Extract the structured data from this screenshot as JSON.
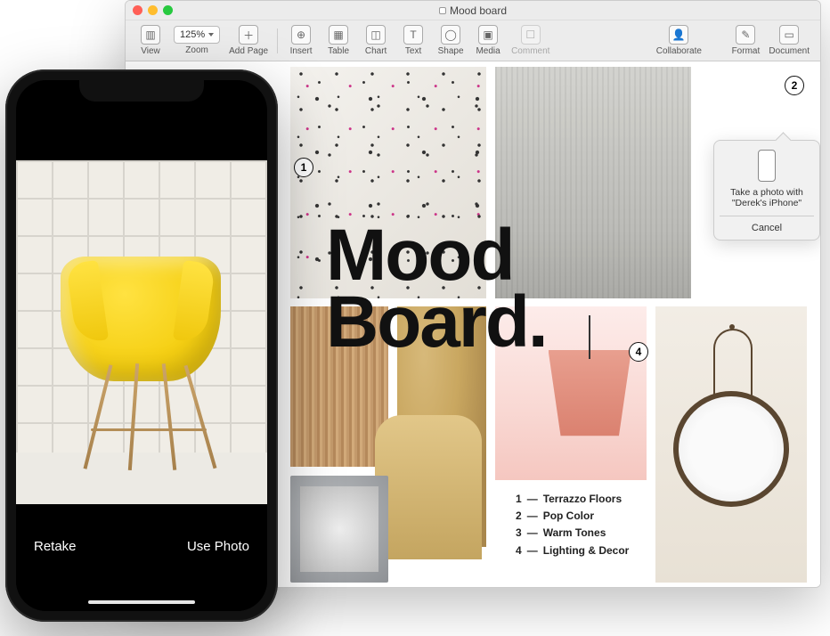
{
  "window": {
    "title": "Mood board",
    "toolbar": {
      "view": "View",
      "zoom_value": "125%",
      "zoom_label": "Zoom",
      "add_page": "Add Page",
      "insert": "Insert",
      "table": "Table",
      "chart": "Chart",
      "text": "Text",
      "shape": "Shape",
      "media": "Media",
      "comment": "Comment",
      "collaborate": "Collaborate",
      "format": "Format",
      "document": "Document"
    }
  },
  "document": {
    "headline_line1": "Mood",
    "headline_line2": "Board.",
    "callouts": {
      "c1": "1",
      "c2": "2",
      "c4": "4"
    },
    "legend": [
      {
        "n": "1",
        "label": "Terrazzo Floors"
      },
      {
        "n": "2",
        "label": "Pop Color"
      },
      {
        "n": "3",
        "label": "Warm Tones"
      },
      {
        "n": "4",
        "label": "Lighting & Decor"
      }
    ]
  },
  "popover": {
    "text_line1": "Take a photo with",
    "text_line2": "\"Derek's iPhone\"",
    "cancel": "Cancel"
  },
  "iphone": {
    "retake": "Retake",
    "use": "Use Photo"
  }
}
